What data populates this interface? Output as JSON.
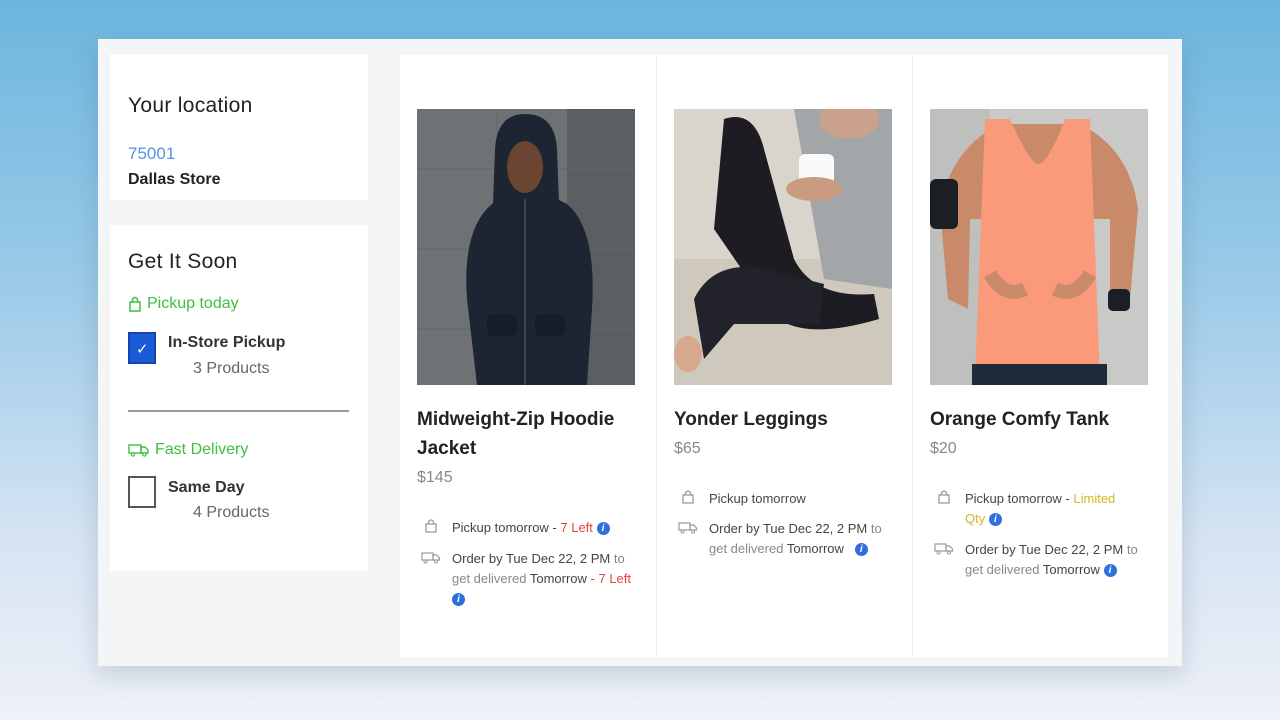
{
  "location": {
    "title": "Your location",
    "zip": "75001",
    "store": "Dallas Store"
  },
  "filters": {
    "title": "Get It Soon",
    "pickup": {
      "label": "Pickup today",
      "option": "In-Store Pickup",
      "count": "3 Products",
      "checked": true
    },
    "delivery": {
      "label": "Fast Delivery",
      "option": "Same Day",
      "count": "4 Products",
      "checked": false
    }
  },
  "products": [
    {
      "name": "Midweight-Zip Hoodie Jacket",
      "price": "$145",
      "pickup_text": "Pickup tomorrow - ",
      "pickup_flag": "7 Left",
      "order_text": "Order by Tue Dec 22, 2 PM",
      "order_to": " to",
      "get_delivered": "get delivered",
      "when": "Tomorrow",
      "delivery_flag_sep": " - ",
      "delivery_flag": "7 Left",
      "photo": "hoodie-photo"
    },
    {
      "name": "Yonder Leggings",
      "price": "$65",
      "pickup_text": "Pickup tomorrow",
      "order_text": "Order by Tue Dec 22, 2 PM",
      "order_to": " to",
      "get_delivered": "get delivered",
      "when": "Tomorrow",
      "photo": "leggings-photo"
    },
    {
      "name": "Orange Comfy Tank",
      "price": "$20",
      "pickup_text": "Pickup tomorrow - ",
      "pickup_flag_a": "Limited",
      "pickup_flag_b": "Qty",
      "order_text": "Order by Tue Dec 22, 2 PM",
      "order_to": " to",
      "get_delivered": "get delivered",
      "when": "Tomorrow",
      "photo": "tank-photo"
    }
  ],
  "icons": {
    "pickup": "bag-icon",
    "delivery": "truck-icon",
    "info": "info-icon",
    "info_glyph": "i",
    "check_glyph": "✓"
  },
  "colors": {
    "accent_green": "#3fbf3f",
    "link_blue": "#5a8fe6",
    "checkbox_blue": "#1a5bd6",
    "stock_red": "#e0453a",
    "limited_gold": "#d6b522"
  }
}
